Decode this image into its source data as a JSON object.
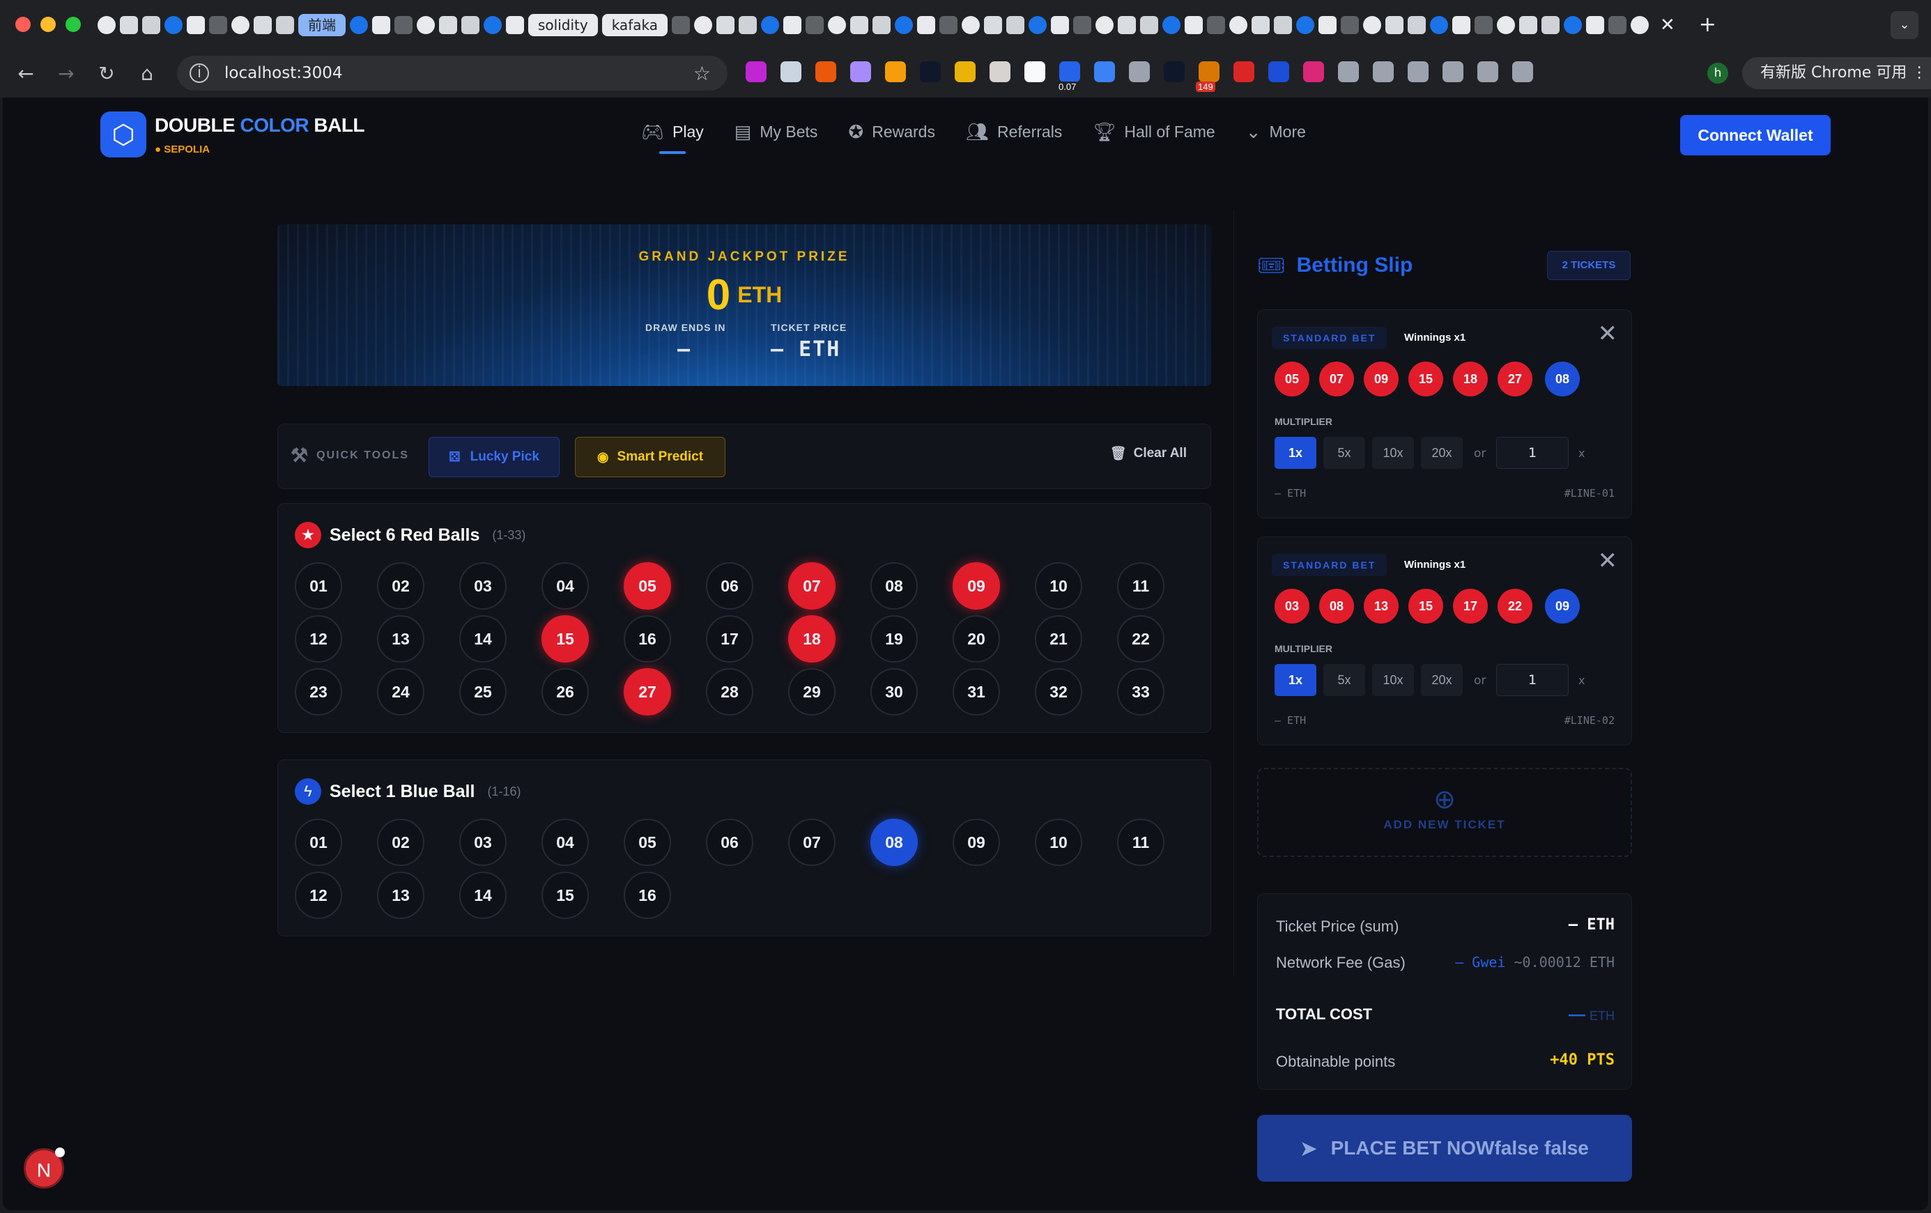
{
  "browser": {
    "tab_chips": [
      "前端",
      "solidity",
      "kafaka"
    ],
    "url": "localhost:3004",
    "ext_badge_1": "0.07",
    "ext_badge_2": "149",
    "update_label": "有新版 Chrome 可用",
    "profile_initial": "h"
  },
  "app": {
    "brand_part1": "DOUBLE ",
    "brand_part2": "COLOR",
    "brand_part3": " BALL",
    "network": "● SEPOLIA",
    "nav": [
      "Play",
      "My Bets",
      "Rewards",
      "Referrals",
      "Hall of Fame",
      "More"
    ],
    "connect_label": "Connect Wallet"
  },
  "hero": {
    "title": "GRAND JACKPOT PRIZE",
    "amount": "0",
    "unit": "ETH",
    "draw_label": "DRAW ENDS IN",
    "draw_value": "–",
    "price_label": "TICKET PRICE",
    "price_value": "– ETH"
  },
  "quick_tools": {
    "label": "QUICK TOOLS",
    "lucky": "Lucky Pick",
    "smart": "Smart Predict",
    "clear": "Clear All"
  },
  "red_panel": {
    "title": "Select 6 Red Balls",
    "range": "(1-33)",
    "balls": [
      "01",
      "02",
      "03",
      "04",
      "05",
      "06",
      "07",
      "08",
      "09",
      "10",
      "11",
      "12",
      "13",
      "14",
      "15",
      "16",
      "17",
      "18",
      "19",
      "20",
      "21",
      "22",
      "23",
      "24",
      "25",
      "26",
      "27",
      "28",
      "29",
      "30",
      "31",
      "32",
      "33"
    ],
    "selected": [
      "05",
      "07",
      "09",
      "15",
      "18",
      "27"
    ]
  },
  "blue_panel": {
    "title": "Select 1 Blue Ball",
    "range": "(1-16)",
    "balls": [
      "01",
      "02",
      "03",
      "04",
      "05",
      "06",
      "07",
      "08",
      "09",
      "10",
      "11",
      "12",
      "13",
      "14",
      "15",
      "16"
    ],
    "selected": [
      "08"
    ]
  },
  "slip": {
    "title": "Betting Slip",
    "tickets_badge": "2 TICKETS",
    "add_label": "ADD NEW TICKET",
    "tickets": [
      {
        "type": "STANDARD BET",
        "winnings": "Winnings x1",
        "red": [
          "05",
          "07",
          "09",
          "15",
          "18",
          "27"
        ],
        "blue": "08",
        "mult_label": "MULTIPLIER",
        "mult": [
          "1x",
          "5x",
          "10x",
          "20x"
        ],
        "or": "or",
        "custom": "1",
        "x": "x",
        "cost": "– ETH",
        "line": "#LINE-01"
      },
      {
        "type": "STANDARD BET",
        "winnings": "Winnings x1",
        "red": [
          "03",
          "08",
          "13",
          "15",
          "17",
          "22"
        ],
        "blue": "09",
        "mult_label": "MULTIPLIER",
        "mult": [
          "1x",
          "5x",
          "10x",
          "20x"
        ],
        "or": "or",
        "custom": "1",
        "x": "x",
        "cost": "– ETH",
        "line": "#LINE-02"
      }
    ]
  },
  "summary": {
    "ticket_price_label": "Ticket Price (sum)",
    "ticket_price_value": "– ETH",
    "gas_label": "Network Fee (Gas)",
    "gas_gwei": "– Gwei",
    "gas_eth": "~0.00012 ETH",
    "total_label": "TOTAL COST",
    "total_dash": "—",
    "total_unit": "ETH",
    "points_label": "Obtainable points",
    "points_value": "+40 PTS"
  },
  "place_bet": "PLACE BET NOWfalse false",
  "dev_badge": "N"
}
